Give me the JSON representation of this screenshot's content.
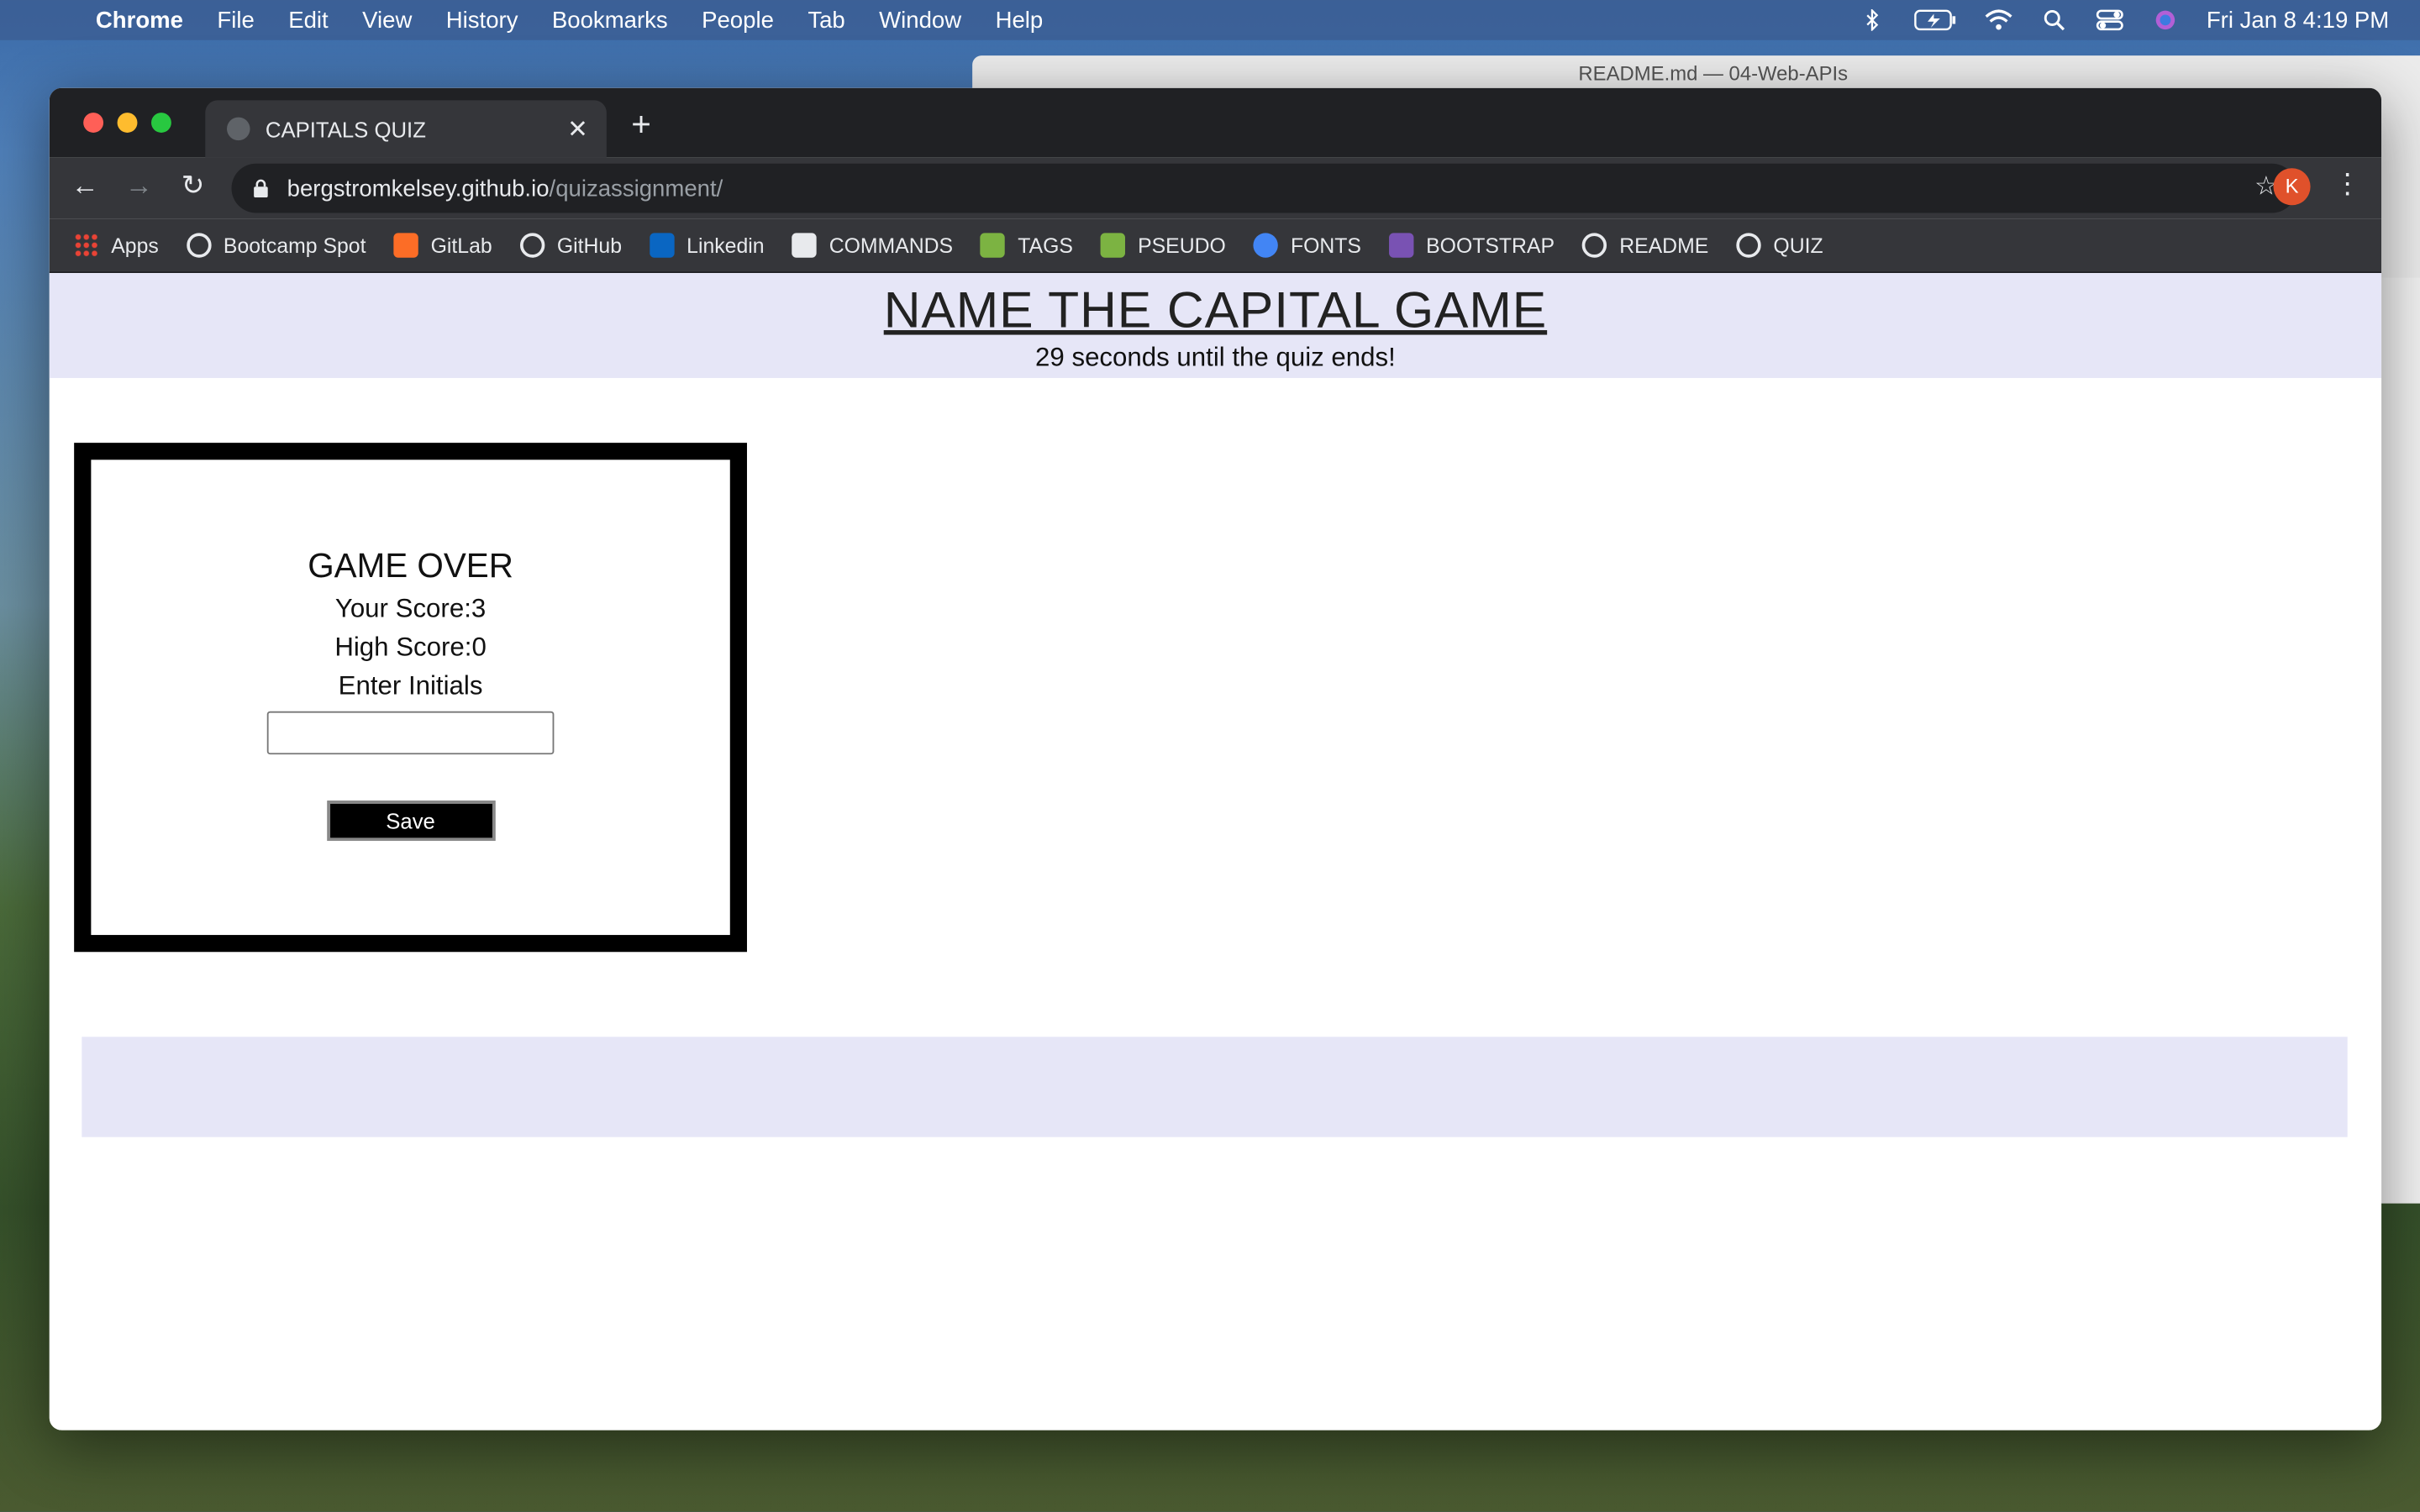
{
  "menubar": {
    "app": "Chrome",
    "items": [
      "File",
      "Edit",
      "View",
      "History",
      "Bookmarks",
      "People",
      "Tab",
      "Window",
      "Help"
    ],
    "clock": "Fri Jan 8  4:19 PM"
  },
  "background_window": {
    "title": "README.md — 04-Web-APIs"
  },
  "browser": {
    "tab_title": "CAPITALS QUIZ",
    "url_host": "bergstromkelsey.github.io",
    "url_path": "/quizassignment/",
    "profile_initial": "K",
    "bookmarks": [
      {
        "label": "Apps",
        "icon": "apps-grid-icon",
        "color": "#ea4335"
      },
      {
        "label": "Bootcamp Spot",
        "icon": "globe-icon",
        "color": "#e8eaed"
      },
      {
        "label": "GitLab",
        "icon": "gitlab-icon",
        "color": "#fc6d26"
      },
      {
        "label": "GitHub",
        "icon": "github-icon",
        "color": "#e8eaed"
      },
      {
        "label": "Linkedin",
        "icon": "linkedin-icon",
        "color": "#0a66c2"
      },
      {
        "label": "COMMANDS",
        "icon": "terminal-icon",
        "color": "#e8eaed"
      },
      {
        "label": "TAGS",
        "icon": "html-tag-icon",
        "color": "#7cb342"
      },
      {
        "label": "PSEUDO",
        "icon": "html-tag-icon",
        "color": "#7cb342"
      },
      {
        "label": "FONTS",
        "icon": "fonts-icon",
        "color": "#4285f4"
      },
      {
        "label": "BOOTSTRAP",
        "icon": "bootstrap-icon",
        "color": "#7952b3"
      },
      {
        "label": "README",
        "icon": "globe-icon",
        "color": "#e8eaed"
      },
      {
        "label": "QUIZ",
        "icon": "globe-icon",
        "color": "#e8eaed"
      }
    ]
  },
  "page": {
    "title": "NAME THE CAPITAL GAME",
    "timer_text": "29 seconds until the quiz ends!",
    "card": {
      "heading": "GAME OVER",
      "score": "Your Score:3",
      "high_score": "High Score:0",
      "prompt": "Enter Initials",
      "initials_value": "",
      "save_label": "Save"
    }
  },
  "colors": {
    "header_band": "#e6e6f7",
    "card_border": "#000000",
    "save_button": "#000000"
  }
}
